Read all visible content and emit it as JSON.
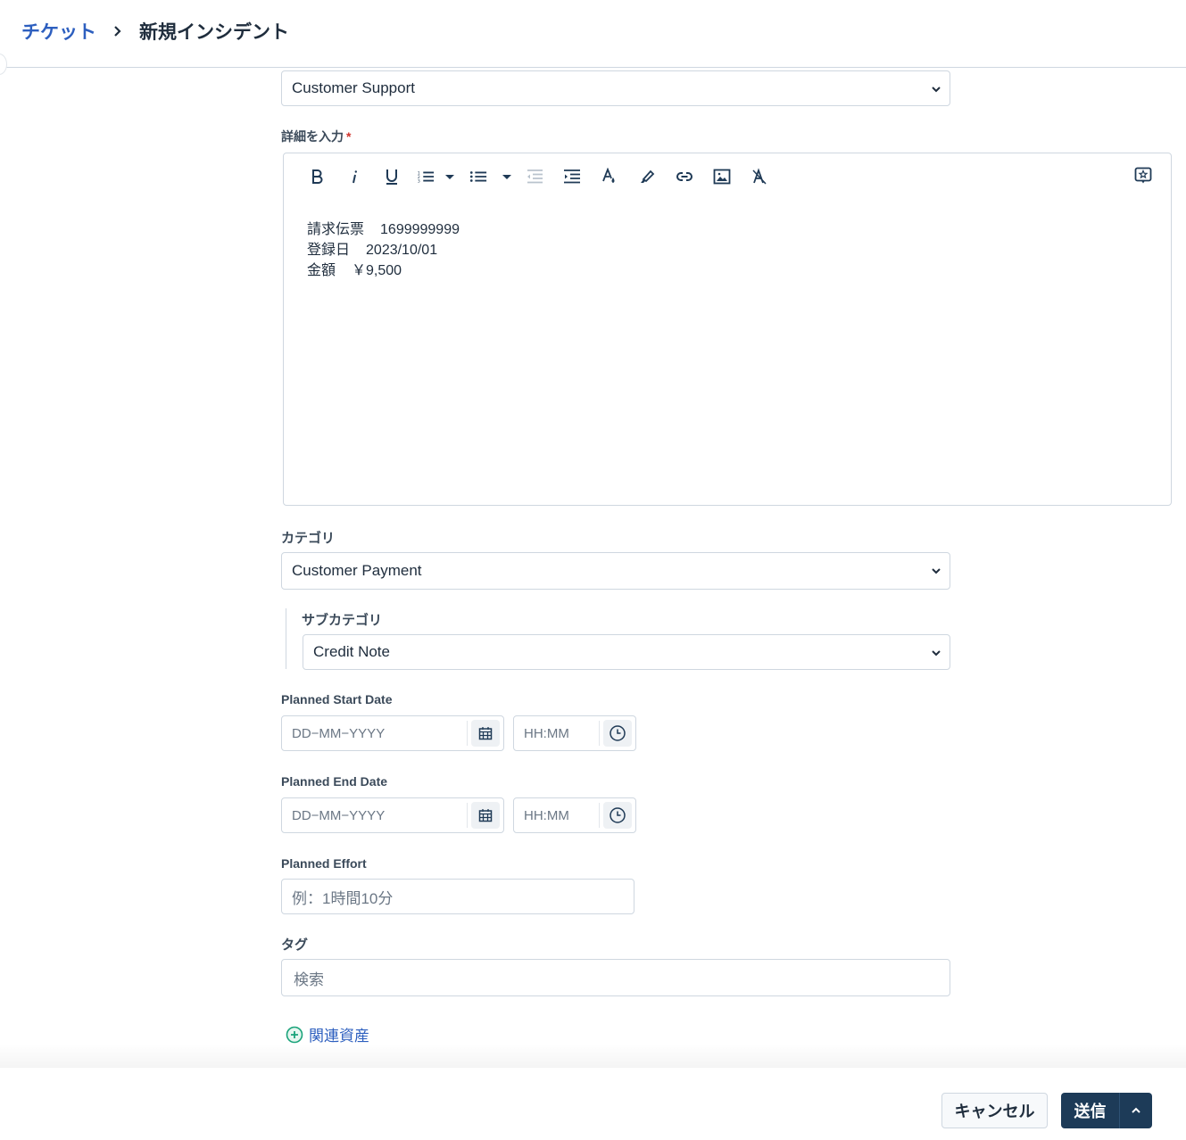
{
  "breadcrumb": {
    "parent": "チケット",
    "current": "新規インシデント"
  },
  "form": {
    "group_select": {
      "value": "Customer Support"
    },
    "description": {
      "label": "詳細を入力",
      "required_marker": "*",
      "toolbar": [
        {
          "icon": "bold-icon"
        },
        {
          "icon": "italic-icon"
        },
        {
          "icon": "underline-icon"
        },
        {
          "icon": "ordered-list-icon"
        },
        {
          "icon": "dropdown-caret-icon"
        },
        {
          "icon": "bulleted-list-icon"
        },
        {
          "icon": "dropdown-caret-icon"
        },
        {
          "icon": "outdent-icon"
        },
        {
          "icon": "indent-icon"
        },
        {
          "icon": "text-color-icon"
        },
        {
          "icon": "highlight-icon"
        },
        {
          "icon": "link-icon"
        },
        {
          "icon": "image-icon"
        },
        {
          "icon": "clear-format-icon"
        }
      ],
      "extra_icon": "canned-response-icon",
      "lines": [
        {
          "key": "請求伝票",
          "value": "1699999999"
        },
        {
          "key": "登録日",
          "value": "2023/10/01"
        },
        {
          "key": "金額",
          "value": "￥9,500"
        }
      ]
    },
    "category": {
      "label": "カテゴリ",
      "value": "Customer Payment"
    },
    "subcategory": {
      "label": "サブカテゴリ",
      "value": "Credit Note"
    },
    "planned_start": {
      "label": "Planned Start Date",
      "date_placeholder": "DD−MM−YYYY",
      "time_placeholder": "HH:MM"
    },
    "planned_end": {
      "label": "Planned End Date",
      "date_placeholder": "DD−MM−YYYY",
      "time_placeholder": "HH:MM"
    },
    "planned_effort": {
      "label": "Planned Effort",
      "placeholder": "例：1時間10分"
    },
    "tags": {
      "label": "タグ",
      "placeholder": "検索"
    },
    "related_assets": {
      "label": "関連資産"
    }
  },
  "footer": {
    "cancel_label": "キャンセル",
    "submit_label": "送信"
  },
  "colors": {
    "link": "#2d5fbf",
    "primary_button": "#1d3b58",
    "required": "#d0342c",
    "add_icon": "#1aa37a"
  }
}
